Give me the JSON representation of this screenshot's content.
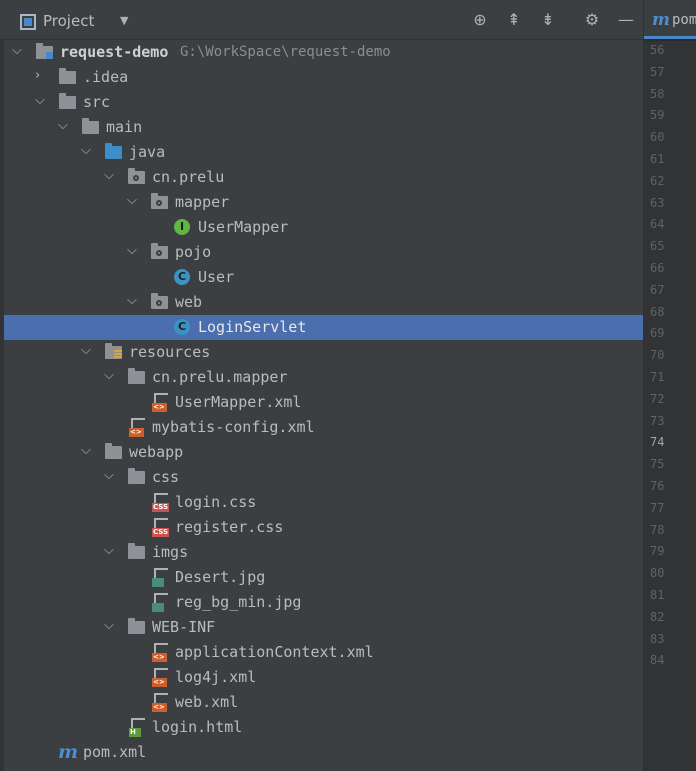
{
  "toolbar": {
    "title": "Project",
    "dropdown": "▼",
    "locate_icon": "⊕",
    "expand_icon": "⇞",
    "collapse_icon": "⇟",
    "settings_icon": "⚙",
    "minimize_icon": "—"
  },
  "tree": {
    "root": {
      "label": "request-demo",
      "path": "G:\\WorkSpace\\request-demo"
    },
    "idea": ".idea",
    "src": "src",
    "main": "main",
    "java": "java",
    "pkg": "cn.prelu",
    "mapper": "mapper",
    "usermapper": "UserMapper",
    "pojo": "pojo",
    "user": "User",
    "web": "web",
    "loginservlet": "LoginServlet",
    "resources": "resources",
    "res_pkg": "cn.prelu.mapper",
    "usermapper_xml": "UserMapper.xml",
    "mybatis": "mybatis-config.xml",
    "webapp": "webapp",
    "css": "css",
    "login_css": "login.css",
    "register_css": "register.css",
    "imgs": "imgs",
    "desert": "Desert.jpg",
    "regbg": "reg_bg_min.jpg",
    "webinf": "WEB-INF",
    "appctx": "applicationContext.xml",
    "log4j": "log4j.xml",
    "webxml": "web.xml",
    "loginhtml": "login.html",
    "pom": "pom.xml"
  },
  "icons": {
    "class": "C",
    "interface": "I",
    "xml_tag": "<>",
    "css_tag": "CSS",
    "html_tag": "H",
    "maven": "m"
  },
  "colors": {
    "selection": "#4b6eaf",
    "background": "#3c3f41"
  },
  "editor": {
    "tab_label": "pom",
    "line_numbers": [
      "56",
      "57",
      "58",
      "59",
      "60",
      "61",
      "62",
      "63",
      "64",
      "65",
      "66",
      "67",
      "68",
      "69",
      "70",
      "71",
      "72",
      "73",
      "74",
      "75",
      "76",
      "77",
      "78",
      "79",
      "80",
      "81",
      "82",
      "83",
      "84"
    ],
    "current_line": "74"
  }
}
